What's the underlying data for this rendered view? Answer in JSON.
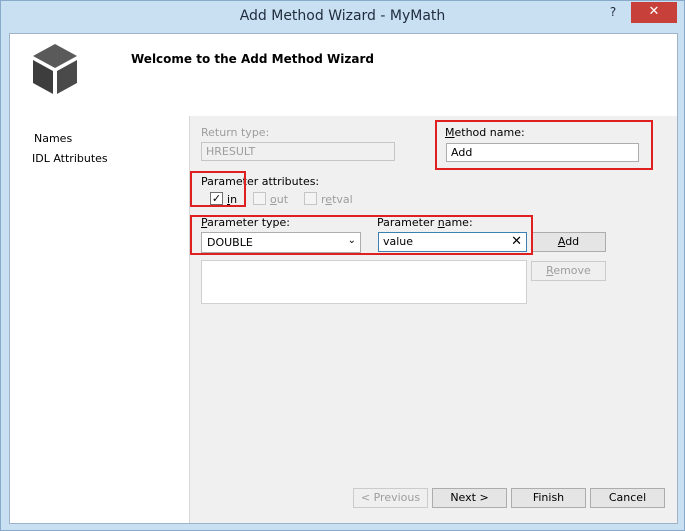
{
  "window": {
    "title": "Add Method Wizard - MyMath",
    "help_label": "?",
    "close_label": "✕"
  },
  "header": {
    "welcome": "Welcome to the Add Method Wizard"
  },
  "nav": {
    "items": [
      "Names",
      "IDL Attributes"
    ]
  },
  "form": {
    "return_type": {
      "label": "Return type:",
      "value": "HRESULT"
    },
    "method_name": {
      "label_pre": "",
      "label_u": "M",
      "label_post": "ethod name:",
      "value": "Add"
    },
    "param_attributes": {
      "label": "Parameter attributes:",
      "in": {
        "label_u": "i",
        "label_post": "n",
        "checked": "✓"
      },
      "out": {
        "label_u": "o",
        "label_post": "ut"
      },
      "retval": {
        "label_pre": "r",
        "label_u": "e",
        "label_post": "tval"
      }
    },
    "param_type": {
      "label_pre": "",
      "label_u": "P",
      "label_post": "arameter type:",
      "value": "DOUBLE"
    },
    "param_name": {
      "label_pre": "Parameter ",
      "label_u": "n",
      "label_post": "ame:",
      "value": "value"
    },
    "add_btn": {
      "label_u": "A",
      "label_post": "dd"
    },
    "remove_btn": {
      "label_u": "R",
      "label_post": "emove"
    }
  },
  "footer": {
    "prev": "< Previous",
    "next": "Next >",
    "finish": "Finish",
    "cancel": "Cancel"
  },
  "colors": {
    "highlight": "#e02020",
    "titlebar": "#c9dff2",
    "close": "#c7413a"
  }
}
